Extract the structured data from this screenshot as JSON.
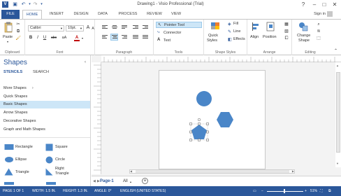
{
  "window": {
    "title": "Drawing1 - Visio Professional (Trial)"
  },
  "titlebar": {
    "help_icon": "?",
    "minimize_icon": "–",
    "restore_icon": "□",
    "close_icon": "✕"
  },
  "tabs": [
    "FILE",
    "HOME",
    "INSERT",
    "DESIGN",
    "DATA",
    "PROCESS",
    "REVIEW",
    "VIEW"
  ],
  "account": {
    "sign_in": "Sign in"
  },
  "ribbon": {
    "clipboard": {
      "label": "Clipboard",
      "paste": "Paste"
    },
    "font": {
      "label": "Font",
      "family": "Calibri",
      "size": "10pt.",
      "grow": "A",
      "shrink": "A",
      "bold": "B",
      "italic": "I",
      "underline": "U",
      "strike": "abc",
      "case": "aA",
      "color": "A"
    },
    "paragraph": {
      "label": "Paragraph"
    },
    "tools": {
      "label": "Tools",
      "pointer": "Pointer Tool",
      "connector": "Connector",
      "text": "Text"
    },
    "shape_styles": {
      "label": "Shape Styles",
      "quick_styles_1": "Quick",
      "quick_styles_2": "Styles",
      "fill": "Fill",
      "line": "Line",
      "effects": "Effects"
    },
    "arrange": {
      "label": "Arrange",
      "align": "Align",
      "position": "Position"
    },
    "editing": {
      "label": "Editing",
      "change_shape_1": "Change",
      "change_shape_2": "Shape"
    }
  },
  "shapes_pane": {
    "title": "Shapes",
    "tabs": [
      "STENCILS",
      "SEARCH"
    ],
    "items": [
      "More Shapes",
      "Quick Shapes",
      "Basic Shapes",
      "Arrow Shapes",
      "Decorative Shapes",
      "Graph and Math Shapes"
    ],
    "selected": "Basic Shapes",
    "stencils": [
      "Rectangle",
      "Square",
      "Ellipse",
      "Circle",
      "Triangle",
      "Right Triangle"
    ]
  },
  "page_tabs": {
    "page": "Page-1",
    "all": "All",
    "add": "+"
  },
  "status": {
    "page": "PAGE 1 OF 1",
    "width": "WIDTH: 1.5 IN.",
    "height": "HEIGHT: 1.3 IN.",
    "angle": "ANGLE: 0°",
    "language": "ENGLISH (UNITED STATES)",
    "zoom": "51%"
  },
  "colors": {
    "accent": "#2b579a",
    "shape_fill": "#4a86c8",
    "selected_item": "#cde6f7"
  }
}
